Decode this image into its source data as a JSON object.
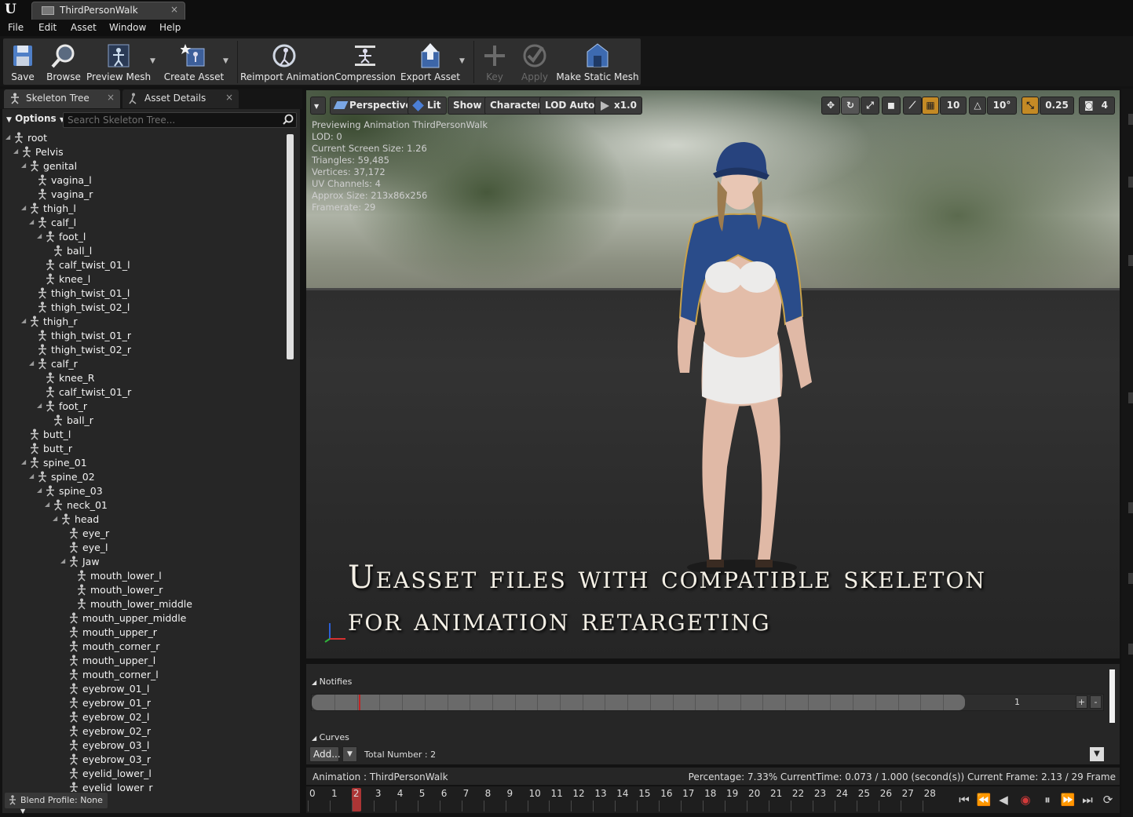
{
  "window": {
    "tab_title": "ThirdPersonWalk",
    "tab_close": "×",
    "logo_letter": "U"
  },
  "menu": [
    "File",
    "Edit",
    "Asset",
    "Window",
    "Help"
  ],
  "toolbar": {
    "save": "Save",
    "browse": "Browse",
    "preview_mesh": "Preview Mesh",
    "create_asset": "Create Asset",
    "reimport": "Reimport Animation",
    "compression": "Compression",
    "export": "Export Asset",
    "key": "Key",
    "apply": "Apply",
    "make_static_mesh": "Make Static Mesh"
  },
  "left_panel": {
    "tabs": [
      {
        "label": "Skeleton Tree"
      },
      {
        "label": "Asset Details"
      }
    ],
    "options_label": "Options",
    "search_placeholder": "Search Skeleton Tree...",
    "bones": [
      {
        "name": "root",
        "d": 0,
        "exp": true
      },
      {
        "name": "Pelvis",
        "d": 1,
        "exp": true
      },
      {
        "name": "genital",
        "d": 2,
        "exp": true
      },
      {
        "name": "vagina_l",
        "d": 3,
        "exp": false
      },
      {
        "name": "vagina_r",
        "d": 3,
        "exp": false
      },
      {
        "name": "thigh_l",
        "d": 2,
        "exp": true
      },
      {
        "name": "calf_l",
        "d": 3,
        "exp": true
      },
      {
        "name": "foot_l",
        "d": 4,
        "exp": true
      },
      {
        "name": "ball_l",
        "d": 5,
        "exp": false
      },
      {
        "name": "calf_twist_01_l",
        "d": 4,
        "exp": false
      },
      {
        "name": "knee_l",
        "d": 4,
        "exp": false
      },
      {
        "name": "thigh_twist_01_l",
        "d": 3,
        "exp": false
      },
      {
        "name": "thigh_twist_02_l",
        "d": 3,
        "exp": false
      },
      {
        "name": "thigh_r",
        "d": 2,
        "exp": true
      },
      {
        "name": "thigh_twist_01_r",
        "d": 3,
        "exp": false
      },
      {
        "name": "thigh_twist_02_r",
        "d": 3,
        "exp": false
      },
      {
        "name": "calf_r",
        "d": 3,
        "exp": true
      },
      {
        "name": "knee_R",
        "d": 4,
        "exp": false
      },
      {
        "name": "calf_twist_01_r",
        "d": 4,
        "exp": false
      },
      {
        "name": "foot_r",
        "d": 4,
        "exp": true
      },
      {
        "name": "ball_r",
        "d": 5,
        "exp": false
      },
      {
        "name": "butt_l",
        "d": 2,
        "exp": false
      },
      {
        "name": "butt_r",
        "d": 2,
        "exp": false
      },
      {
        "name": "spine_01",
        "d": 2,
        "exp": true
      },
      {
        "name": "spine_02",
        "d": 3,
        "exp": true
      },
      {
        "name": "spine_03",
        "d": 4,
        "exp": true
      },
      {
        "name": "neck_01",
        "d": 5,
        "exp": true
      },
      {
        "name": "head",
        "d": 6,
        "exp": true
      },
      {
        "name": "eye_r",
        "d": 7,
        "exp": false
      },
      {
        "name": "eye_l",
        "d": 7,
        "exp": false
      },
      {
        "name": "Jaw",
        "d": 7,
        "exp": true
      },
      {
        "name": "mouth_lower_l",
        "d": 8,
        "exp": false
      },
      {
        "name": "mouth_lower_r",
        "d": 8,
        "exp": false
      },
      {
        "name": "mouth_lower_middle",
        "d": 8,
        "exp": false
      },
      {
        "name": "mouth_upper_middle",
        "d": 7,
        "exp": false
      },
      {
        "name": "mouth_upper_r",
        "d": 7,
        "exp": false
      },
      {
        "name": "mouth_corner_r",
        "d": 7,
        "exp": false
      },
      {
        "name": "mouth_upper_l",
        "d": 7,
        "exp": false
      },
      {
        "name": "mouth_corner_l",
        "d": 7,
        "exp": false
      },
      {
        "name": "eyebrow_01_l",
        "d": 7,
        "exp": false
      },
      {
        "name": "eyebrow_01_r",
        "d": 7,
        "exp": false
      },
      {
        "name": "eyebrow_02_l",
        "d": 7,
        "exp": false
      },
      {
        "name": "eyebrow_02_r",
        "d": 7,
        "exp": false
      },
      {
        "name": "eyebrow_03_l",
        "d": 7,
        "exp": false
      },
      {
        "name": "eyebrow_03_r",
        "d": 7,
        "exp": false
      },
      {
        "name": "eyelid_lower_l",
        "d": 7,
        "exp": false
      },
      {
        "name": "eyelid_lower_r",
        "d": 7,
        "exp": false
      }
    ],
    "blend_profile": "Blend Profile: None"
  },
  "viewport": {
    "buttons": {
      "perspective": "Perspective",
      "lit": "Lit",
      "show": "Show",
      "character": "Character",
      "lod": "LOD Auto",
      "speed": "x1.0"
    },
    "right_values": {
      "grid": "10",
      "rot": "10°",
      "scale": "0.25",
      "cam_speed": "4"
    },
    "info": [
      "Previewing Animation ThirdPersonWalk",
      "LOD: 0",
      "Current Screen Size: 1.26",
      "Triangles: 59,485",
      "Vertices: 37,172",
      "UV Channels: 4",
      "Approx Size: 213x86x256",
      "Framerate: 29"
    ],
    "overlay_line1": "Ueasset files with compatible skeleton",
    "overlay_line2": "for animation retargeting"
  },
  "notifies": {
    "label": "Notifies",
    "track_value": "1",
    "plus": "+",
    "minus": "-",
    "curves_label": "Curves",
    "add_label": "Add...",
    "total_number": "Total Number : 2"
  },
  "status": {
    "animation": "Animation :  ThirdPersonWalk",
    "details": "Percentage:  7.33% CurrentTime:  0.073 / 1.000 (second(s)) Current Frame:  2.13 / 29 Frame"
  },
  "timeline": {
    "ticks": [
      "0",
      "1",
      "2",
      "3",
      "4",
      "5",
      "6",
      "7",
      "8",
      "9",
      "10",
      "11",
      "12",
      "13",
      "14",
      "15",
      "16",
      "17",
      "18",
      "19",
      "20",
      "21",
      "22",
      "23",
      "24",
      "25",
      "26",
      "27",
      "28"
    ],
    "current_frame_index": 2
  }
}
